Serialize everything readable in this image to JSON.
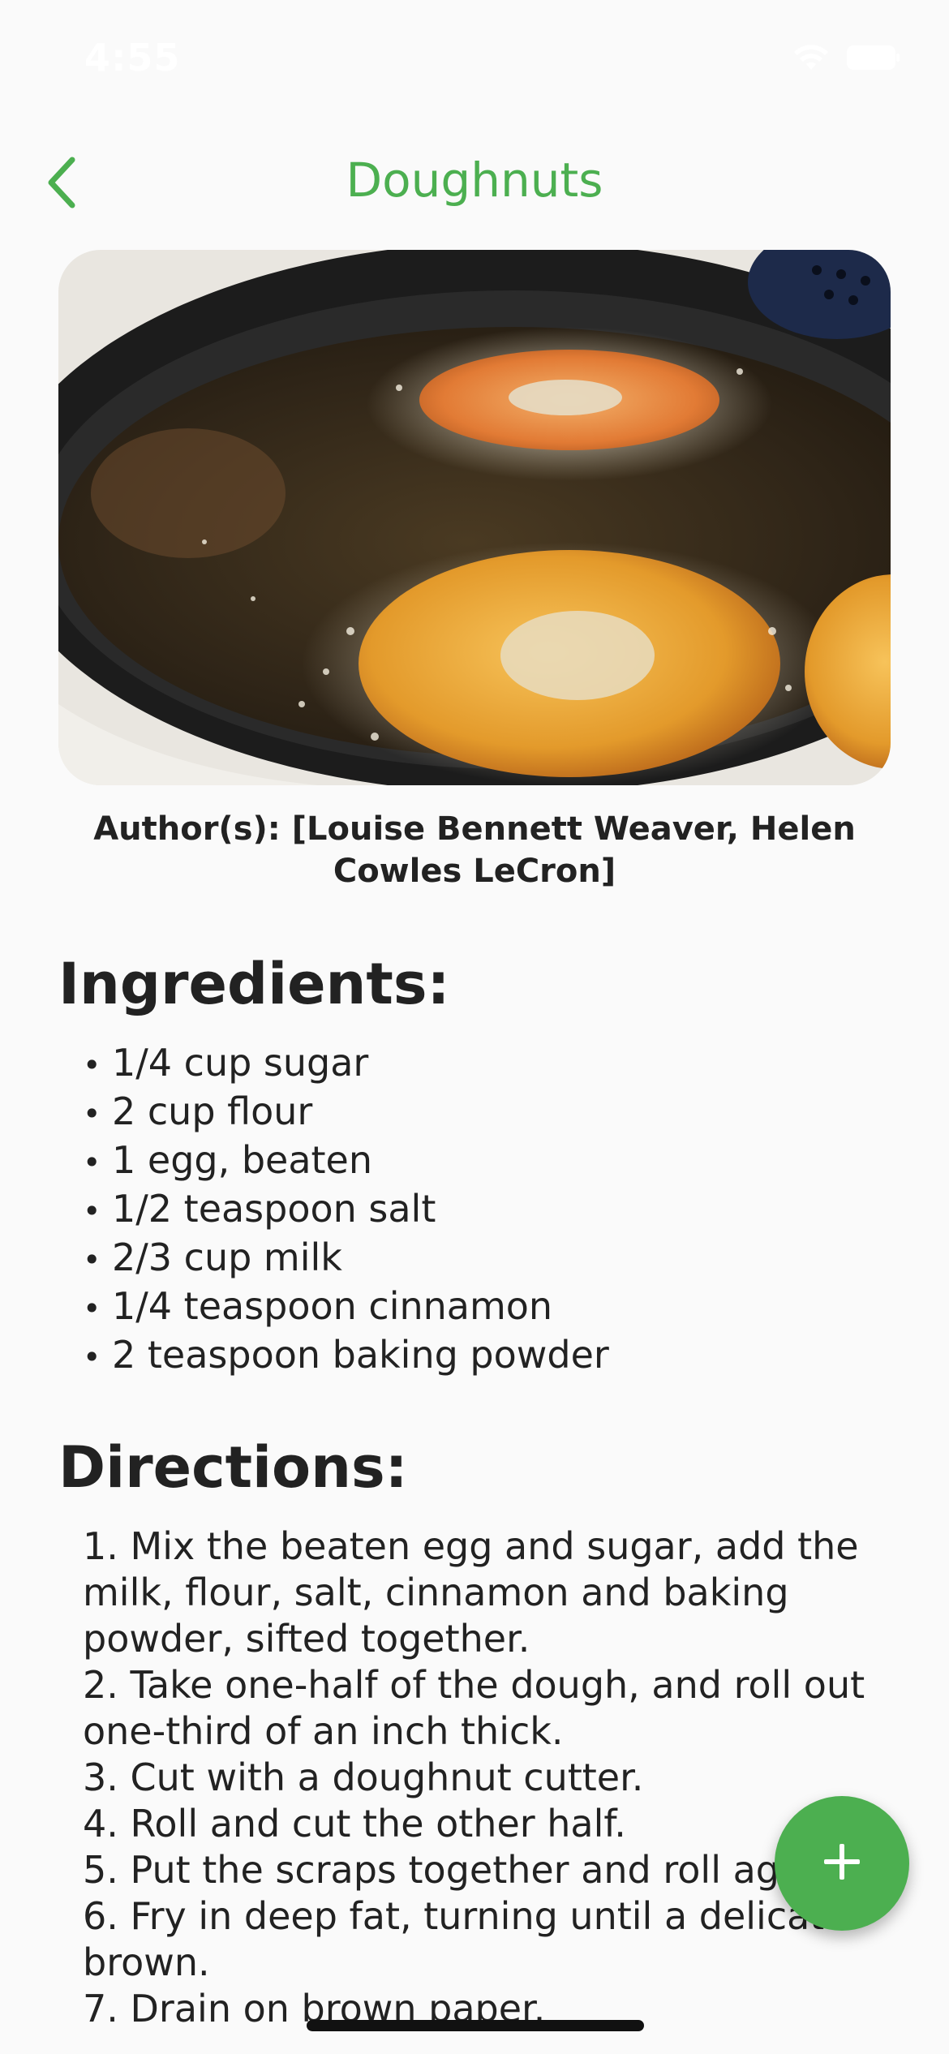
{
  "status_bar": {
    "time": "4:55"
  },
  "nav": {
    "title": "Doughnuts",
    "back_icon": "chevron-left-icon"
  },
  "recipe": {
    "image_description_icon": "recipe-photo",
    "authors": "Author(s): [Louise Bennett Weaver, Helen Cowles LeCron]",
    "ingredients_heading": "Ingredients:",
    "ingredients": [
      "1/4 cup sugar",
      "2 cup flour",
      "1 egg, beaten",
      "1/2 teaspoon salt",
      "2/3 cup milk",
      "1/4 teaspoon cinnamon",
      "2 teaspoon baking powder"
    ],
    "directions_heading": "Directions:",
    "directions": [
      "1. Mix the beaten egg and sugar, add the milk, flour, salt, cinnamon and baking powder, sifted together.",
      "2. Take one-half of the dough, and roll out one-third of an inch thick.",
      "3. Cut with a doughnut cutter.",
      "4. Roll and cut the other half.",
      "5. Put the scraps together and roll again.",
      "6. Fry in deep fat, turning until a delicate brown.",
      "7. Drain on brown paper."
    ]
  },
  "fab": {
    "icon": "plus-icon"
  },
  "colors": {
    "accent": "#4caf50",
    "background": "#fafafa",
    "text": "#222222"
  }
}
